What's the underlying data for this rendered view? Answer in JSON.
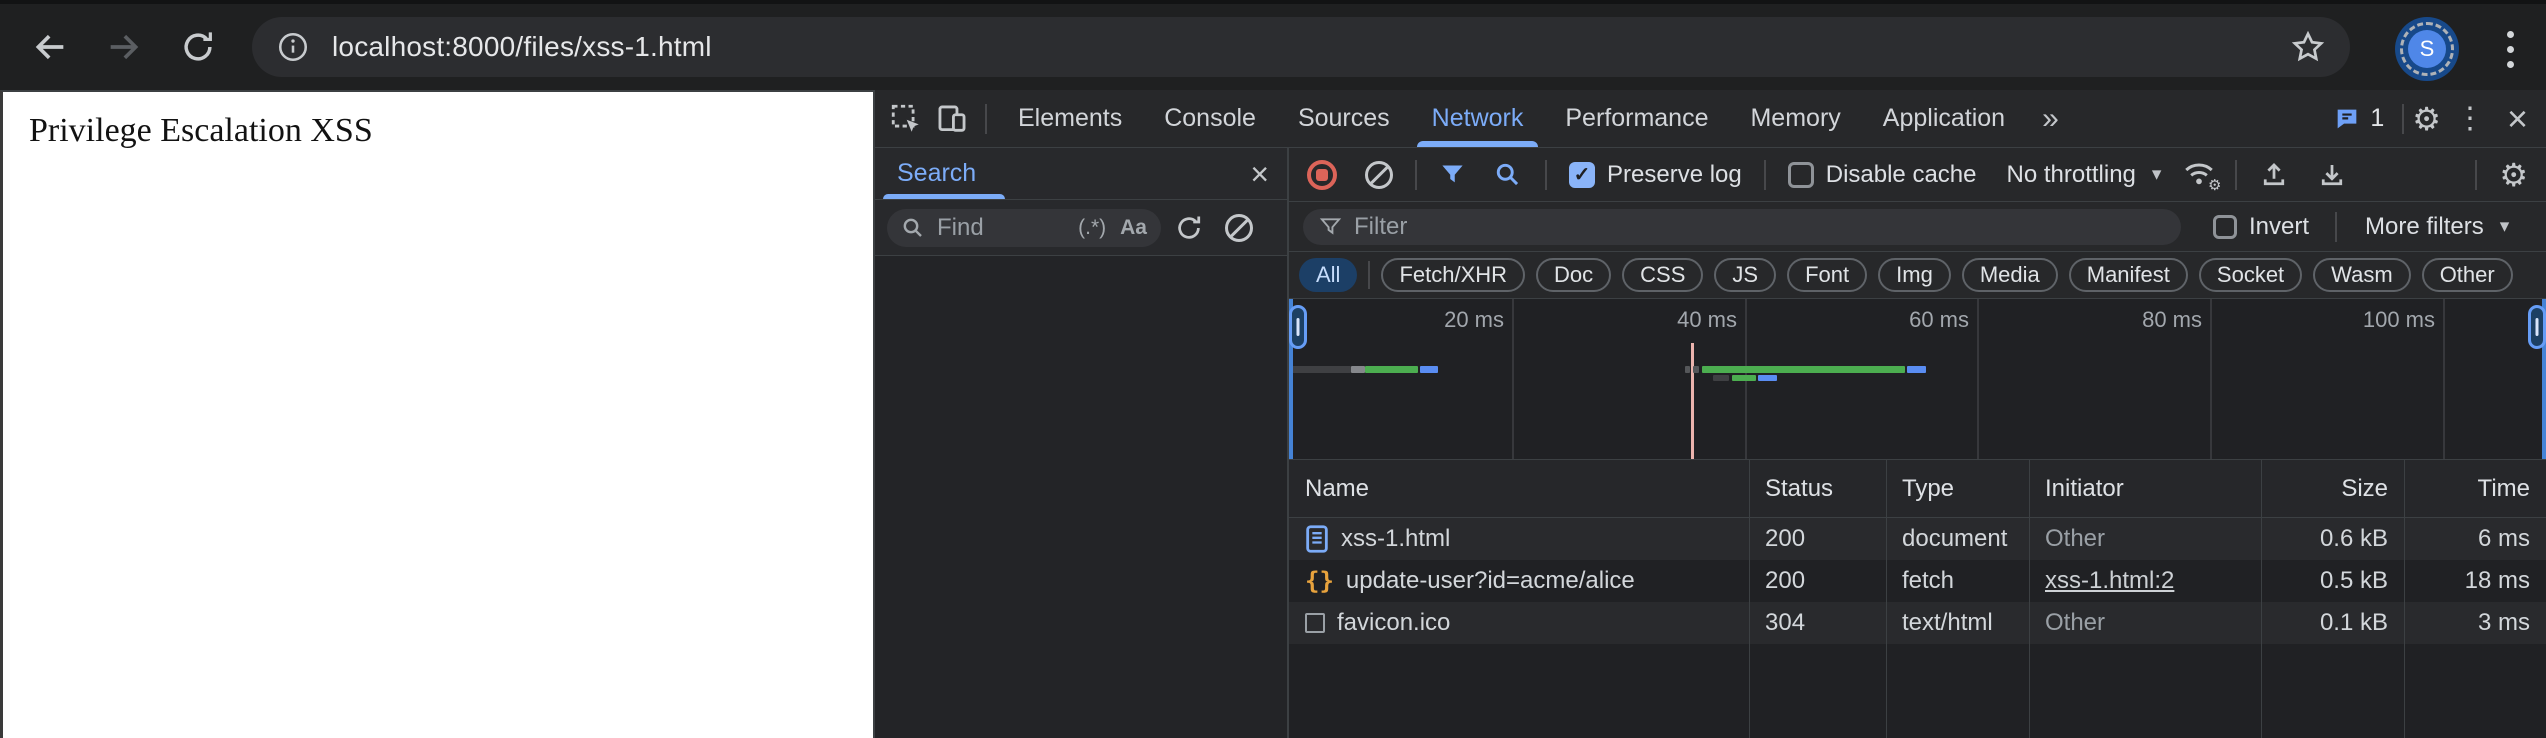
{
  "browser": {
    "url": "localhost:8000/files/xss-1.html",
    "profile_initial": "S"
  },
  "page": {
    "heading": "Privilege Escalation XSS"
  },
  "devtools": {
    "tabs": [
      "Elements",
      "Console",
      "Sources",
      "Network",
      "Performance",
      "Memory",
      "Application"
    ],
    "active_tab": "Network",
    "more_tabs_glyph": "»",
    "issues_count": "1",
    "search_panel": {
      "title": "Search",
      "find_placeholder": "Find",
      "regex_label": "(.*)",
      "case_label": "Aa"
    },
    "network": {
      "toolbar": {
        "preserve_log": "Preserve log",
        "disable_cache": "Disable cache",
        "throttling": "No throttling"
      },
      "filter": {
        "placeholder": "Filter",
        "invert": "Invert",
        "more_filters": "More filters"
      },
      "chips": [
        "All",
        "Fetch/XHR",
        "Doc",
        "CSS",
        "JS",
        "Font",
        "Img",
        "Media",
        "Manifest",
        "Socket",
        "Wasm",
        "Other"
      ],
      "active_chip": "All",
      "overview": {
        "time_labels": [
          "20 ms",
          "40 ms",
          "60 ms",
          "80 ms",
          "100 ms"
        ]
      },
      "table": {
        "columns": [
          "Name",
          "Status",
          "Type",
          "Initiator",
          "Size",
          "Time"
        ],
        "rows": [
          {
            "name": "xss-1.html",
            "status": "200",
            "type": "document",
            "initiator": "Other",
            "size": "0.6 kB",
            "time": "6 ms"
          },
          {
            "name": "update-user?id=acme/alice",
            "status": "200",
            "type": "fetch",
            "initiator": "xss-1.html:2",
            "size": "0.5 kB",
            "time": "18 ms"
          },
          {
            "name": "favicon.ico",
            "status": "304",
            "type": "text/html",
            "initiator": "Other",
            "size": "0.1 kB",
            "time": "3 ms"
          }
        ]
      }
    }
  },
  "colors": {
    "accent_blue": "#7cacf8",
    "record_red": "#dc6459",
    "bar_green": "#4cae50",
    "bar_blue": "#5a8df2",
    "event_line": "#ecb4ae"
  }
}
